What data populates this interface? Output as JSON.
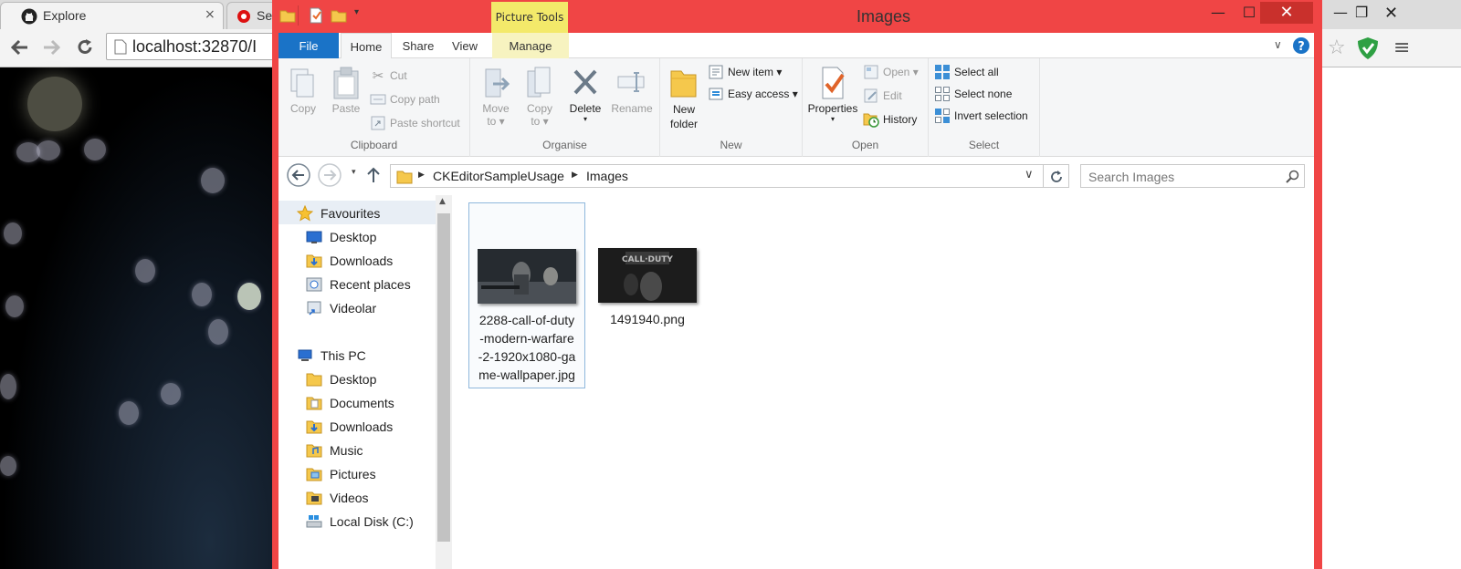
{
  "browser": {
    "tabs": [
      {
        "label": "Explore",
        "close": "×"
      },
      {
        "label": "Se"
      }
    ],
    "address": "localhost:32870/I"
  },
  "window": {
    "title": "Images",
    "context_tab_group": "Picture Tools",
    "caption": {
      "minimize": "—",
      "maximize": "☐",
      "close": "✕"
    }
  },
  "ribbon": {
    "tabs": {
      "file": "File",
      "home": "Home",
      "share": "Share",
      "view": "View",
      "manage": "Manage"
    },
    "clipboard": {
      "label": "Clipboard",
      "copy": "Copy",
      "paste": "Paste",
      "cut": "Cut",
      "copy_path": "Copy path",
      "paste_shortcut": "Paste shortcut"
    },
    "organise": {
      "label": "Organise",
      "move_to": "Move to ▾",
      "copy_to": "Copy to ▾",
      "delete": "Delete",
      "rename": "Rename"
    },
    "new": {
      "label": "New",
      "new_folder": "New folder",
      "new_item": "New item ▾",
      "easy_access": "Easy access ▾"
    },
    "open": {
      "label": "Open",
      "properties": "Properties",
      "open": "Open ▾",
      "edit": "Edit",
      "history": "History"
    },
    "select": {
      "label": "Select",
      "select_all": "Select all",
      "select_none": "Select none",
      "invert_selection": "Invert selection"
    }
  },
  "address_bar": {
    "path": [
      "CKEditorSampleUsage",
      "Images"
    ],
    "search_placeholder": "Search Images"
  },
  "nav_pane": {
    "favourites": {
      "label": "Favourites",
      "items": [
        "Desktop",
        "Downloads",
        "Recent places",
        "Videolar"
      ]
    },
    "this_pc": {
      "label": "This PC",
      "items": [
        "Desktop",
        "Documents",
        "Downloads",
        "Music",
        "Pictures",
        "Videos",
        "Local Disk (C:)"
      ]
    }
  },
  "files": [
    {
      "name": "2288-call-of-duty-modern-warfare-2-1920x1080-game-wallpaper.jpg",
      "lines": [
        "2288-call-of-duty",
        "-modern-warfare",
        "-2-1920x1080-ga",
        "me-wallpaper.jpg"
      ],
      "selected": true
    },
    {
      "name": "1491940.png",
      "lines": [
        "1491940.png"
      ],
      "selected": false
    }
  ],
  "colors": {
    "window_frame": "#f04545",
    "file_tab": "#1a73c7",
    "context_tab": "#f3e96a",
    "close_button": "#c9302c"
  }
}
